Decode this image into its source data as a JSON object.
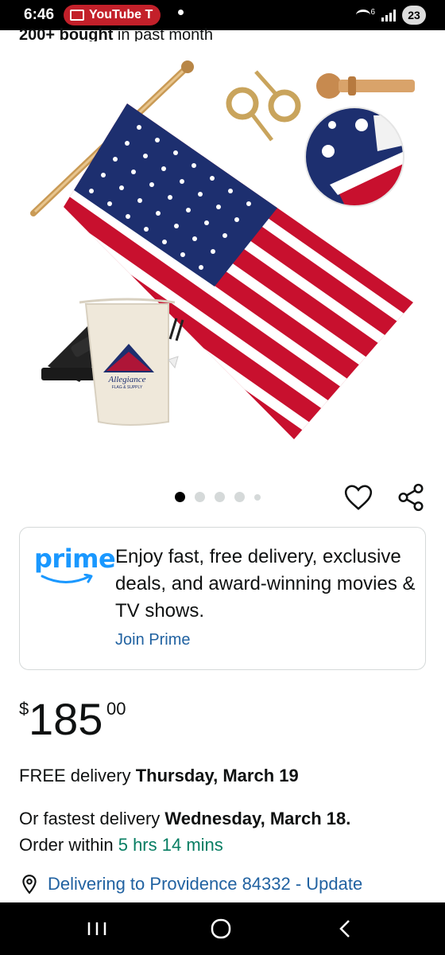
{
  "status_bar": {
    "time": "6:46",
    "notification_app": "YouTube T",
    "battery": "23",
    "network": "6"
  },
  "product": {
    "bought_count": "200+ bought",
    "bought_suffix": " in past month",
    "image_brand_text": "Allegiance",
    "image_brand_sub": "FLAG & SUPPLY",
    "image_count": 5,
    "image_index": 1
  },
  "prime": {
    "logo": "prime",
    "message": "Enjoy fast, free delivery, exclusive deals, and award-winning movies & TV shows.",
    "join_label": "Join Prime"
  },
  "price": {
    "symbol": "$",
    "whole": "185",
    "fraction": "00"
  },
  "delivery": {
    "free_prefix": "FREE delivery ",
    "free_date": "Thursday, March 19",
    "fastest_prefix": "Or fastest delivery ",
    "fastest_date": "Wednesday, March 18.",
    "order_within_prefix": "Order within ",
    "order_within_time": "5 hrs 14 mins",
    "location_label": "Delivering to Providence 84332 - Update"
  },
  "colors": {
    "prime_blue": "#1a98ff",
    "link_blue": "#2162a1",
    "countdown_green": "#067d62",
    "flag_red": "#c8102e",
    "flag_blue": "#1d2f6f"
  }
}
